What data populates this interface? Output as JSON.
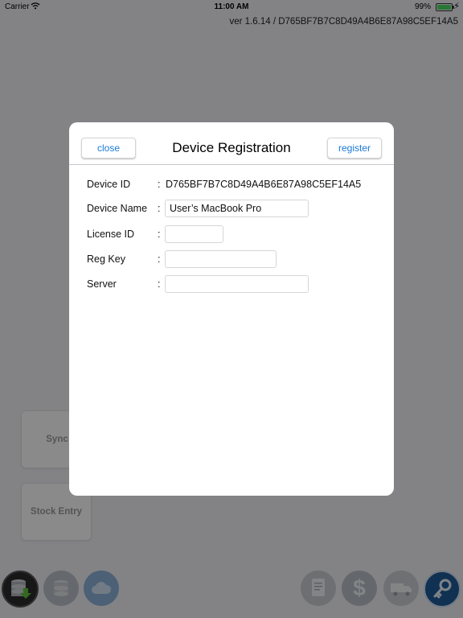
{
  "status_bar": {
    "carrier": "Carrier",
    "time": "11:00 AM",
    "battery_percent": "99%",
    "battery_level": 0.99,
    "battery_color": "#4cd964"
  },
  "version_text": "ver 1.6.14 / D765BF7B7C8D49A4B6E87A98C5EF14A5",
  "background_tiles": {
    "sync": "Sync",
    "stock_entry": "Stock Entry"
  },
  "toolbar": {
    "icons": [
      "database-download-icon",
      "database-icon",
      "cloud-icon",
      "document-icon",
      "dollar-icon",
      "truck-icon",
      "key-icon"
    ]
  },
  "modal": {
    "title": "Device Registration",
    "close_label": "close",
    "register_label": "register",
    "accent_color": "#1a7bd8",
    "fields": {
      "device_id": {
        "label": "Device ID",
        "value": "D765BF7B7C8D49A4B6E87A98C5EF14A5"
      },
      "device_name": {
        "label": "Device Name",
        "value": "User’s MacBook Pro"
      },
      "license_id": {
        "label": "License ID",
        "value": ""
      },
      "reg_key": {
        "label": "Reg Key",
        "value": ""
      },
      "server": {
        "label": "Server",
        "value": ""
      }
    },
    "separator": ":"
  }
}
